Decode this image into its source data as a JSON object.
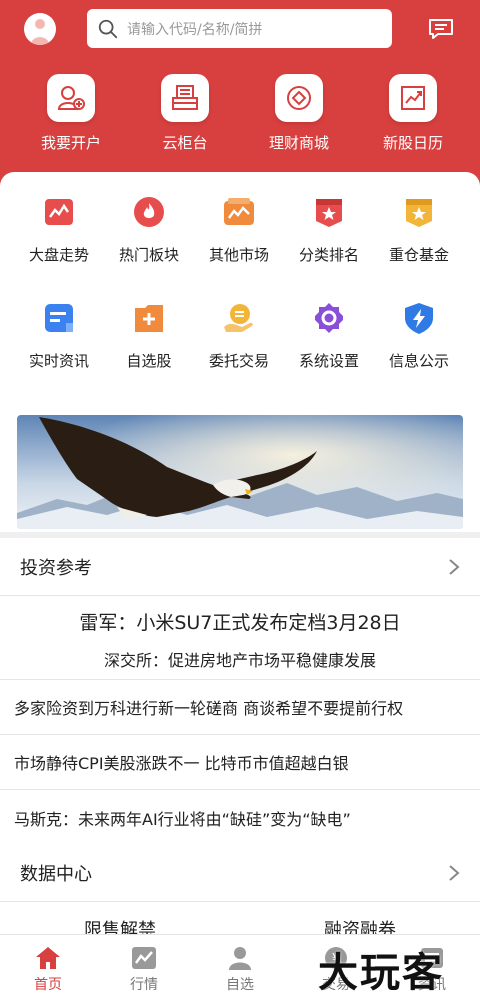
{
  "search": {
    "placeholder": "请输入代码/名称/简拼"
  },
  "quick_actions": [
    {
      "label": "我要开户",
      "icon": "open-account-icon"
    },
    {
      "label": "云柜台",
      "icon": "cloud-counter-icon"
    },
    {
      "label": "理财商城",
      "icon": "wealth-mall-icon"
    },
    {
      "label": "新股日历",
      "icon": "ipo-calendar-icon"
    }
  ],
  "grid": [
    {
      "label": "大盘走势",
      "icon": "market-trend-icon",
      "color": "#e84d4d"
    },
    {
      "label": "热门板块",
      "icon": "hot-sector-icon",
      "color": "#e84d4d"
    },
    {
      "label": "其他市场",
      "icon": "other-market-icon",
      "color": "#f08a3c"
    },
    {
      "label": "分类排名",
      "icon": "ranking-icon",
      "color": "#e84d4d"
    },
    {
      "label": "重仓基金",
      "icon": "fund-icon",
      "color": "#f2b53a"
    },
    {
      "label": "实时资讯",
      "icon": "realtime-news-icon",
      "color": "#3b82f0"
    },
    {
      "label": "自选股",
      "icon": "watchlist-icon",
      "color": "#f08a3c"
    },
    {
      "label": "委托交易",
      "icon": "entrust-trade-icon",
      "color": "#f2b53a"
    },
    {
      "label": "系统设置",
      "icon": "settings-icon",
      "color": "#8a4fd8"
    },
    {
      "label": "信息公示",
      "icon": "info-disclosure-icon",
      "color": "#2f7ae5"
    }
  ],
  "invest": {
    "title": "投资参考",
    "headline": "雷军：小米SU7正式发布定档3月28日",
    "subheadline": "深交所：促进房地产市场平稳健康发展",
    "news": [
      "多家险资到万科进行新一轮磋商 商谈希望不要提前行权",
      "市场静待CPI美股涨跌不一 比特币市值超越白银",
      "马斯克：未来两年AI行业将由“缺硅”变为“缺电”"
    ]
  },
  "data_center": {
    "title": "数据中心",
    "tabs": [
      "限售解禁",
      "融资融券"
    ]
  },
  "bottom_nav": [
    {
      "label": "首页",
      "icon": "home-icon",
      "active": true
    },
    {
      "label": "行情",
      "icon": "market-icon",
      "active": false
    },
    {
      "label": "自选",
      "icon": "user-icon",
      "active": false
    },
    {
      "label": "交易",
      "icon": "trade-icon",
      "active": false
    },
    {
      "label": "资讯",
      "icon": "news-icon",
      "active": false
    }
  ],
  "watermark": "大玩客",
  "colors": {
    "brand_red": "#d8403f"
  }
}
